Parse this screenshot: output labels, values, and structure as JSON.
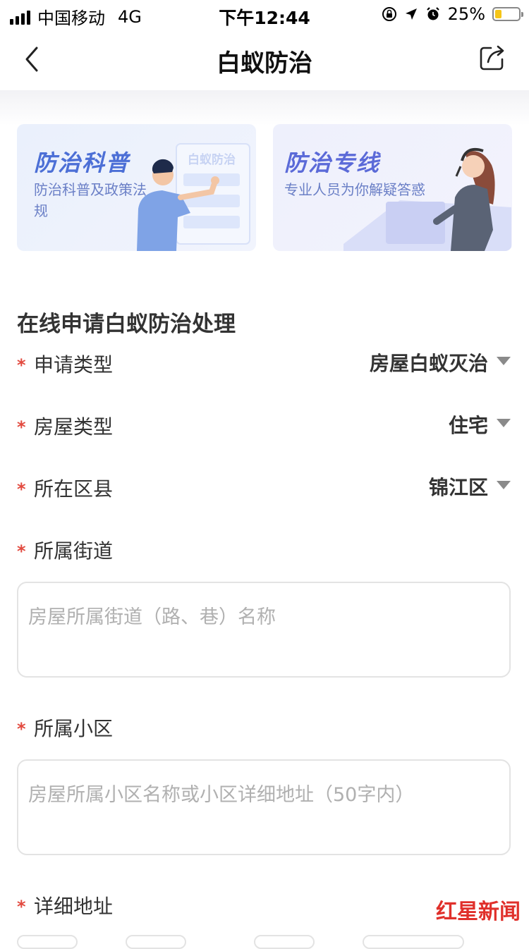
{
  "status_bar": {
    "carrier": "中国移动",
    "network": "4G",
    "time": "下午12:44",
    "battery": "25%"
  },
  "nav": {
    "title": "白蚁防治",
    "back_icon": "chevron-left-icon",
    "share_icon": "share-icon"
  },
  "cards": [
    {
      "title": "防治科普",
      "subtitle": "防治科普及政策法规",
      "illustration_text": "白蚁防治"
    },
    {
      "title": "防治专线",
      "subtitle": "专业人员为你解疑答惑"
    }
  ],
  "form": {
    "section_title": "在线申请白蚁防治处理",
    "required_mark": "*",
    "fields": [
      {
        "label": "申请类型",
        "value": "房屋白蚁灭治"
      },
      {
        "label": "房屋类型",
        "value": "住宅"
      },
      {
        "label": "所在区县",
        "value": "锦江区"
      },
      {
        "label": "所属街道",
        "placeholder": "房屋所属街道（路、巷）名称"
      },
      {
        "label": "所属小区",
        "placeholder": "房屋所属小区名称或小区详细地址（50字内）"
      },
      {
        "label": "详细地址"
      }
    ]
  },
  "watermark": "红星新闻",
  "colors": {
    "accent": "#4c6fd6",
    "required": "#e24a3f",
    "watermark": "#e0302b"
  }
}
